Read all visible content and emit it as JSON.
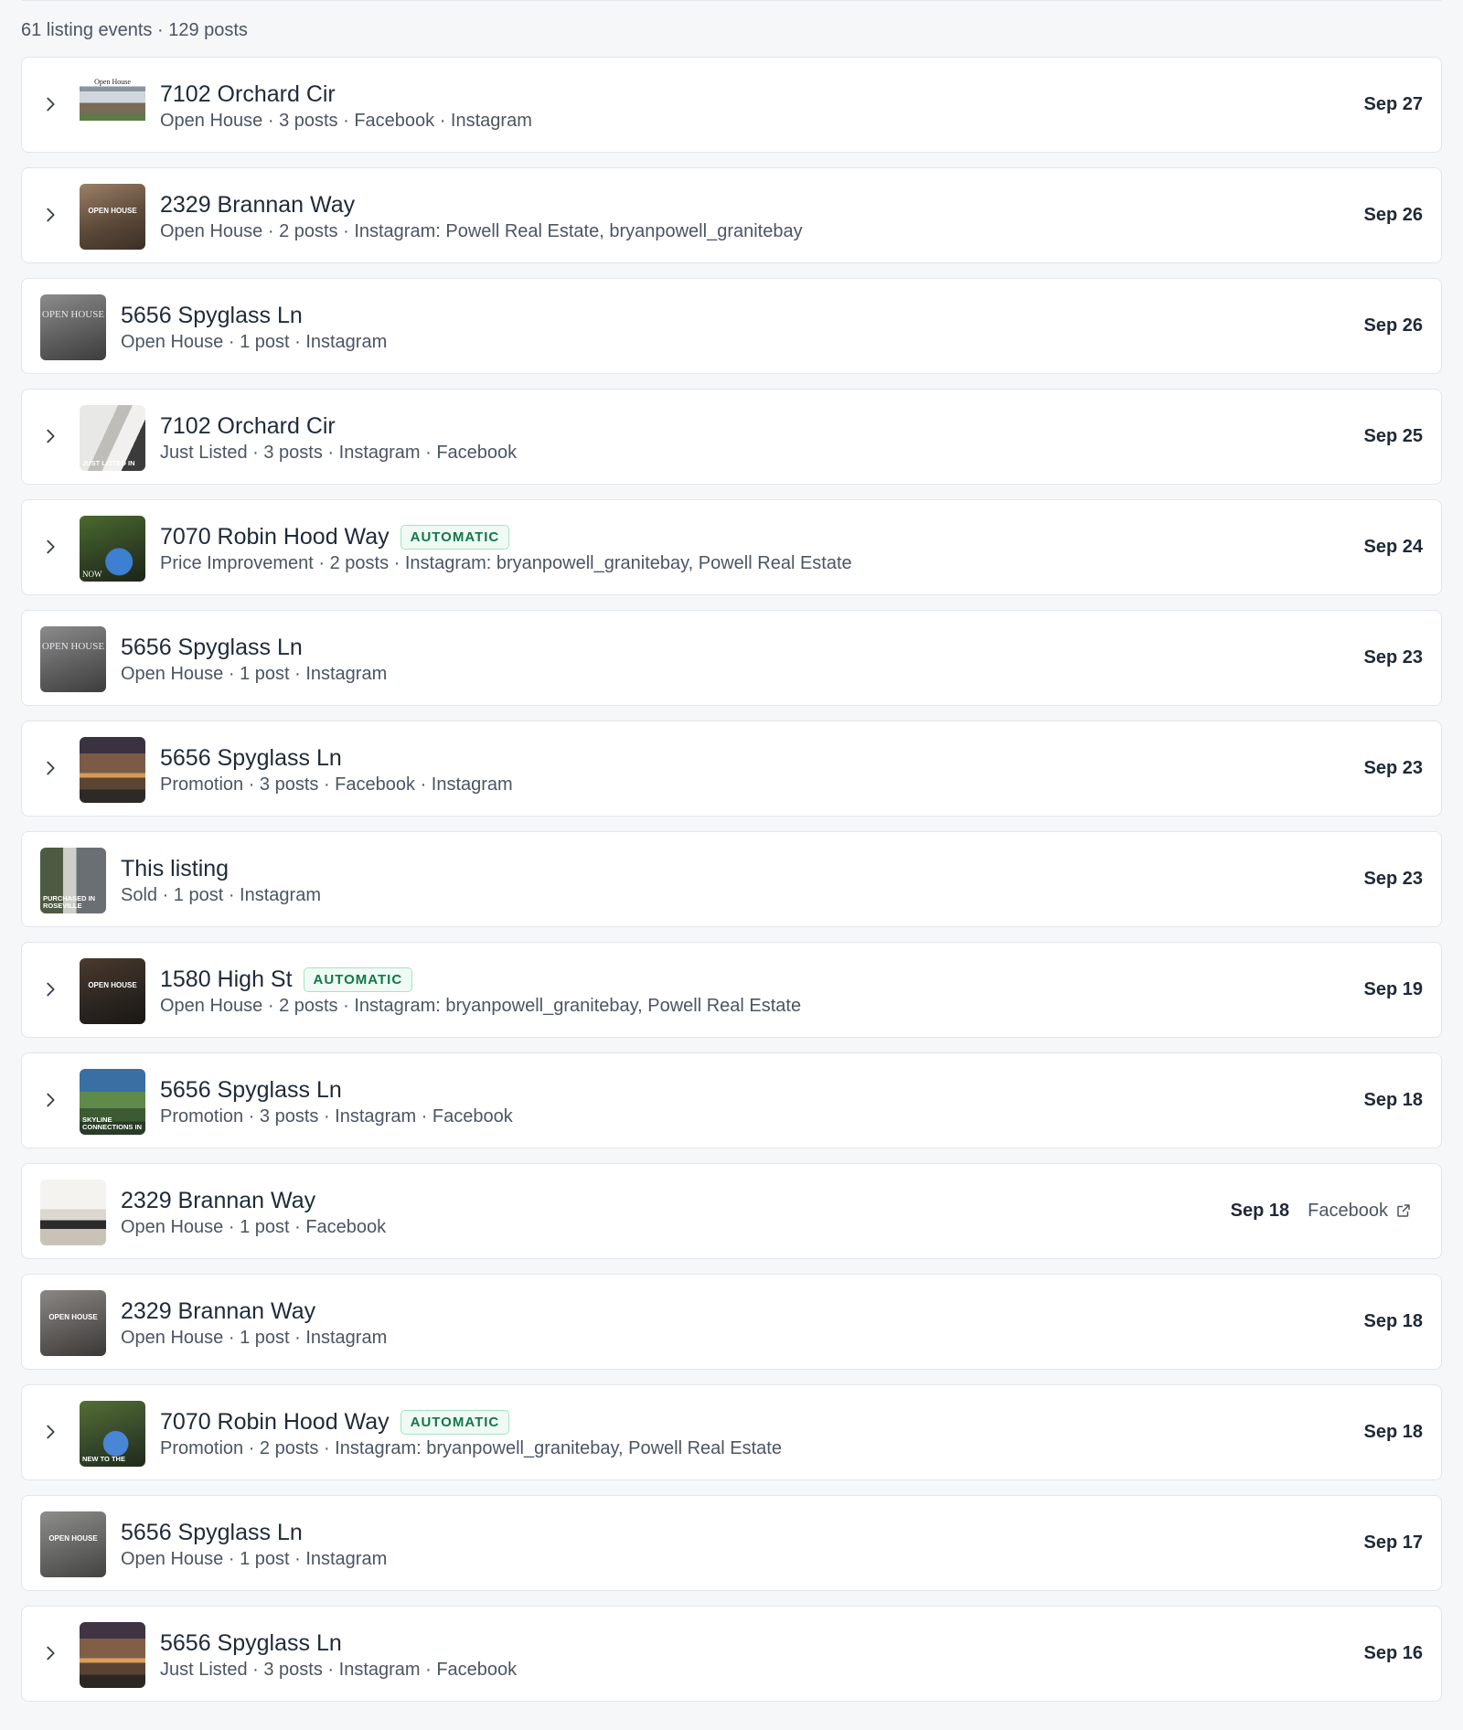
{
  "summary": "61 listing events · 129 posts",
  "badge_label": "AUTOMATIC",
  "events": [
    {
      "title": "7102 Orchard Cir",
      "meta": "Open House · 3 posts · Facebook · Instagram",
      "date": "Sep 27",
      "expandable": true,
      "thumb": "flyer-white"
    },
    {
      "title": "2329 Brannan Way",
      "meta": "Open House · 2 posts · Instagram: Powell Real Estate, bryanpowell_granitebay",
      "date": "Sep 26",
      "expandable": true,
      "thumb": "open-house-brown"
    },
    {
      "title": "5656 Spyglass Ln",
      "meta": "Open House · 1 post · Instagram",
      "date": "Sep 26",
      "expandable": false,
      "thumb": "open-house-gray"
    },
    {
      "title": "7102 Orchard Cir",
      "meta": "Just Listed · 3 posts · Instagram · Facebook",
      "date": "Sep 25",
      "expandable": true,
      "thumb": "stairs"
    },
    {
      "title": "7070 Robin Hood Way",
      "badge": true,
      "meta": "Price Improvement · 2 posts · Instagram: bryanpowell_granitebay, Powell Real Estate",
      "date": "Sep 24",
      "expandable": true,
      "thumb": "pool"
    },
    {
      "title": "5656 Spyglass Ln",
      "meta": "Open House · 1 post · Instagram",
      "date": "Sep 23",
      "expandable": false,
      "thumb": "open-house-gray"
    },
    {
      "title": "5656 Spyglass Ln",
      "meta": "Promotion · 3 posts · Facebook · Instagram",
      "date": "Sep 23",
      "expandable": true,
      "thumb": "house-dusk"
    },
    {
      "title": "This listing",
      "meta": "Sold · 1 post · Instagram",
      "date": "Sep 23",
      "expandable": false,
      "thumb": "purchased"
    },
    {
      "title": "1580 High St",
      "badge": true,
      "meta": "Open House · 2 posts · Instagram: bryanpowell_granitebay, Powell Real Estate",
      "date": "Sep 19",
      "expandable": true,
      "thumb": "open-house-dark"
    },
    {
      "title": "5656 Spyglass Ln",
      "meta": "Promotion · 3 posts · Instagram · Facebook",
      "date": "Sep 18",
      "expandable": true,
      "thumb": "skyline"
    },
    {
      "title": "2329 Brannan Way",
      "meta": "Open House · 1 post · Facebook",
      "date": "Sep 18",
      "expandable": false,
      "thumb": "interior",
      "link": "Facebook"
    },
    {
      "title": "2329 Brannan Way",
      "meta": "Open House · 1 post · Instagram",
      "date": "Sep 18",
      "expandable": false,
      "thumb": "open-house-interior"
    },
    {
      "title": "7070 Robin Hood Way",
      "badge": true,
      "meta": "Promotion · 2 posts · Instagram: bryanpowell_granitebay, Powell Real Estate",
      "date": "Sep 18",
      "expandable": true,
      "thumb": "pool-new"
    },
    {
      "title": "5656 Spyglass Ln",
      "meta": "Open House · 1 post · Instagram",
      "date": "Sep 17",
      "expandable": false,
      "thumb": "open-house-kitchen"
    },
    {
      "title": "5656 Spyglass Ln",
      "meta": "Just Listed · 3 posts · Instagram · Facebook",
      "date": "Sep 16",
      "expandable": true,
      "thumb": "house-dusk-2"
    }
  ],
  "thumb_text": {
    "flyer_header": "Open House",
    "open_house": "OPEN HOUSE",
    "open_house_serif": "OPEN HOUSE",
    "just_listed": "JUST LISTED IN",
    "now": "NOW",
    "purchased": "PURCHASED IN ROSEVILLE",
    "skyline": "SKYLINE CONNECTIONS IN",
    "new_to": "NEW TO THE"
  }
}
